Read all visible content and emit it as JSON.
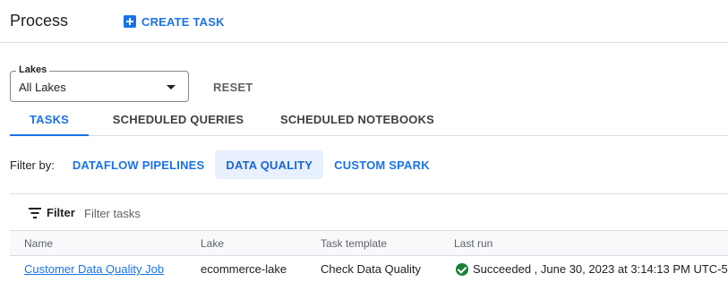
{
  "header": {
    "title": "Process",
    "create_task_label": "CREATE TASK"
  },
  "lakes": {
    "label": "Lakes",
    "value": "All Lakes",
    "reset_label": "RESET"
  },
  "tabs": [
    {
      "label": "TASKS",
      "active": true
    },
    {
      "label": "SCHEDULED QUERIES",
      "active": false
    },
    {
      "label": "SCHEDULED NOTEBOOKS",
      "active": false
    }
  ],
  "filter_by": {
    "label": "Filter by:",
    "chips": [
      {
        "label": "DATAFLOW PIPELINES",
        "active": false
      },
      {
        "label": "DATA QUALITY",
        "active": true
      },
      {
        "label": "CUSTOM SPARK",
        "active": false
      }
    ]
  },
  "filter": {
    "label": "Filter",
    "placeholder": "Filter tasks"
  },
  "table": {
    "columns": [
      "Name",
      "Lake",
      "Task template",
      "Last run"
    ],
    "rows": [
      {
        "name": "Customer Data Quality Job",
        "lake": "ecommerce-lake",
        "template": "Check Data Quality",
        "last_run": "Succeeded , June 30, 2023 at 3:14:13 PM UTC-5",
        "status_icon": "check-circle-icon"
      }
    ]
  },
  "colors": {
    "accent": "#1a73e8",
    "success": "#188038",
    "chip_active_bg": "#e8f0fe",
    "border": "#dadce0"
  }
}
